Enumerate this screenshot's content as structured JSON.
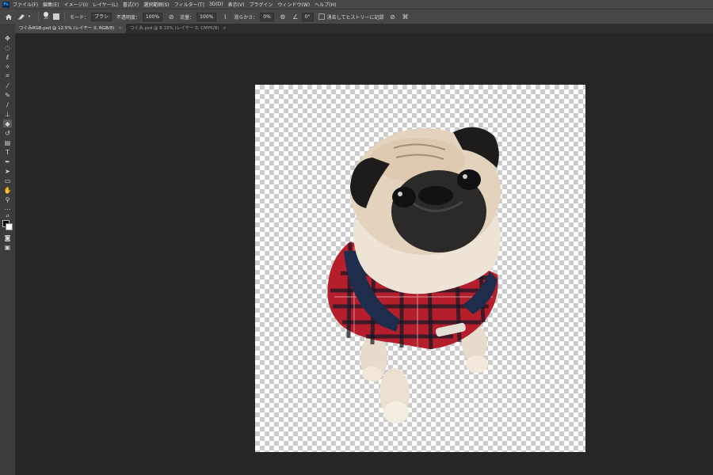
{
  "app": {
    "logo": "Ps"
  },
  "menu": [
    "ファイル(F)",
    "編集(E)",
    "イメージ(I)",
    "レイヤー(L)",
    "書式(Y)",
    "選択範囲(S)",
    "フィルター(T)",
    "3D(D)",
    "表示(V)",
    "プラグイン",
    "ウィンドウ(W)",
    "ヘルプ(H)"
  ],
  "options": {
    "brush_size": "30",
    "mode_label": "モード：",
    "mode_value": "ブラシ",
    "opacity_label": "不透明度：",
    "opacity_value": "100%",
    "flow_label": "流量：",
    "flow_value": "100%",
    "smoothing_label": "滑らかさ：",
    "smoothing_value": "0%",
    "angle_value": "0°",
    "history_label": "消去してヒストリーに記録"
  },
  "tabs": [
    {
      "label": "つぐみRGB.psd @ 12.5% (レイヤー 0, RGB/8)",
      "active": true
    },
    {
      "label": "つぐみ.psd @ 8.33% (レイヤー 0, CMYK/8)",
      "active": false
    }
  ],
  "tools": [
    "move-tool",
    "marquee-tool",
    "lasso-tool",
    "magic-wand-tool",
    "crop-tool",
    "eyedropper-tool",
    "healing-tool",
    "brush-tool",
    "stamp-tool",
    "history-brush-tool",
    "eraser-tool",
    "gradient-tool",
    "type-tool",
    "pen-tool",
    "path-selection-tool",
    "rectangle-tool",
    "hand-tool",
    "zoom-tool",
    "more-tools"
  ],
  "colors": {
    "foreground": "#000000",
    "background": "#ffffff",
    "workspace": "#262626",
    "panel": "#474747"
  }
}
